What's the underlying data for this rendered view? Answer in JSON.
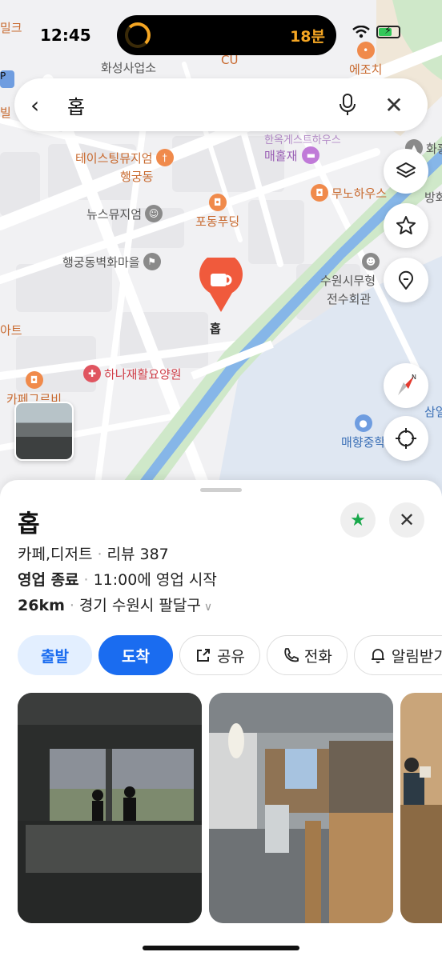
{
  "status": {
    "time": "12:45",
    "activity": "18분"
  },
  "search": {
    "query": "홉"
  },
  "map": {
    "pois": [
      {
        "label": "밀크",
        "color": "orange"
      },
      {
        "label": "화성사업소",
        "color": "gray"
      },
      {
        "label": "CU",
        "color": "orange"
      },
      {
        "label": "에조치",
        "color": "orange"
      },
      {
        "label": "한옥게스트하우스",
        "color": "purple"
      },
      {
        "label": "매홀재",
        "color": "purple"
      },
      {
        "label": "테이스팅뮤지엄",
        "color": "orange"
      },
      {
        "label": "행궁동",
        "color": "orange"
      },
      {
        "label": "뉴스뮤지엄",
        "color": "gray"
      },
      {
        "label": "포동푸딩",
        "color": "orange"
      },
      {
        "label": "무노하우스",
        "color": "orange"
      },
      {
        "label": "화홍",
        "color": "gray"
      },
      {
        "label": "방화",
        "color": "gray"
      },
      {
        "label": "행궁동벽화마을",
        "color": "gray"
      },
      {
        "label": "수원시무형",
        "color": "gray"
      },
      {
        "label": "전수회관",
        "color": "gray"
      },
      {
        "label": "하나재활요양원",
        "color": "red"
      },
      {
        "label": "카페그르비",
        "color": "orange"
      },
      {
        "label": "매향중학",
        "color": "blue"
      },
      {
        "label": "삼일",
        "color": "blue"
      },
      {
        "label": "아트",
        "color": "orange"
      },
      {
        "label": "빌",
        "color": "orange"
      }
    ],
    "selected_marker": {
      "label": "홉"
    },
    "buttons": {
      "layers": "layers-icon",
      "favorites": "star-icon",
      "pin": "location-pin-icon",
      "compass": "compass-icon",
      "my_location": "crosshair-icon"
    }
  },
  "place": {
    "name": "홉",
    "category": "카페,디저트",
    "reviews": "리뷰 387",
    "hours_status": "영업 종료",
    "hours_detail": "11:00에 영업 시작",
    "distance": "26km",
    "address": "경기 수원시 팔달구"
  },
  "actions": {
    "depart": "출발",
    "arrive": "도착",
    "share": "공유",
    "call": "전화",
    "notify": "알림받기"
  },
  "colors": {
    "primary": "#1a6cf0",
    "primary_light": "#e3efff",
    "favorite": "#18a84a",
    "marker": "#f05a3c",
    "river": "#86b6e8"
  }
}
